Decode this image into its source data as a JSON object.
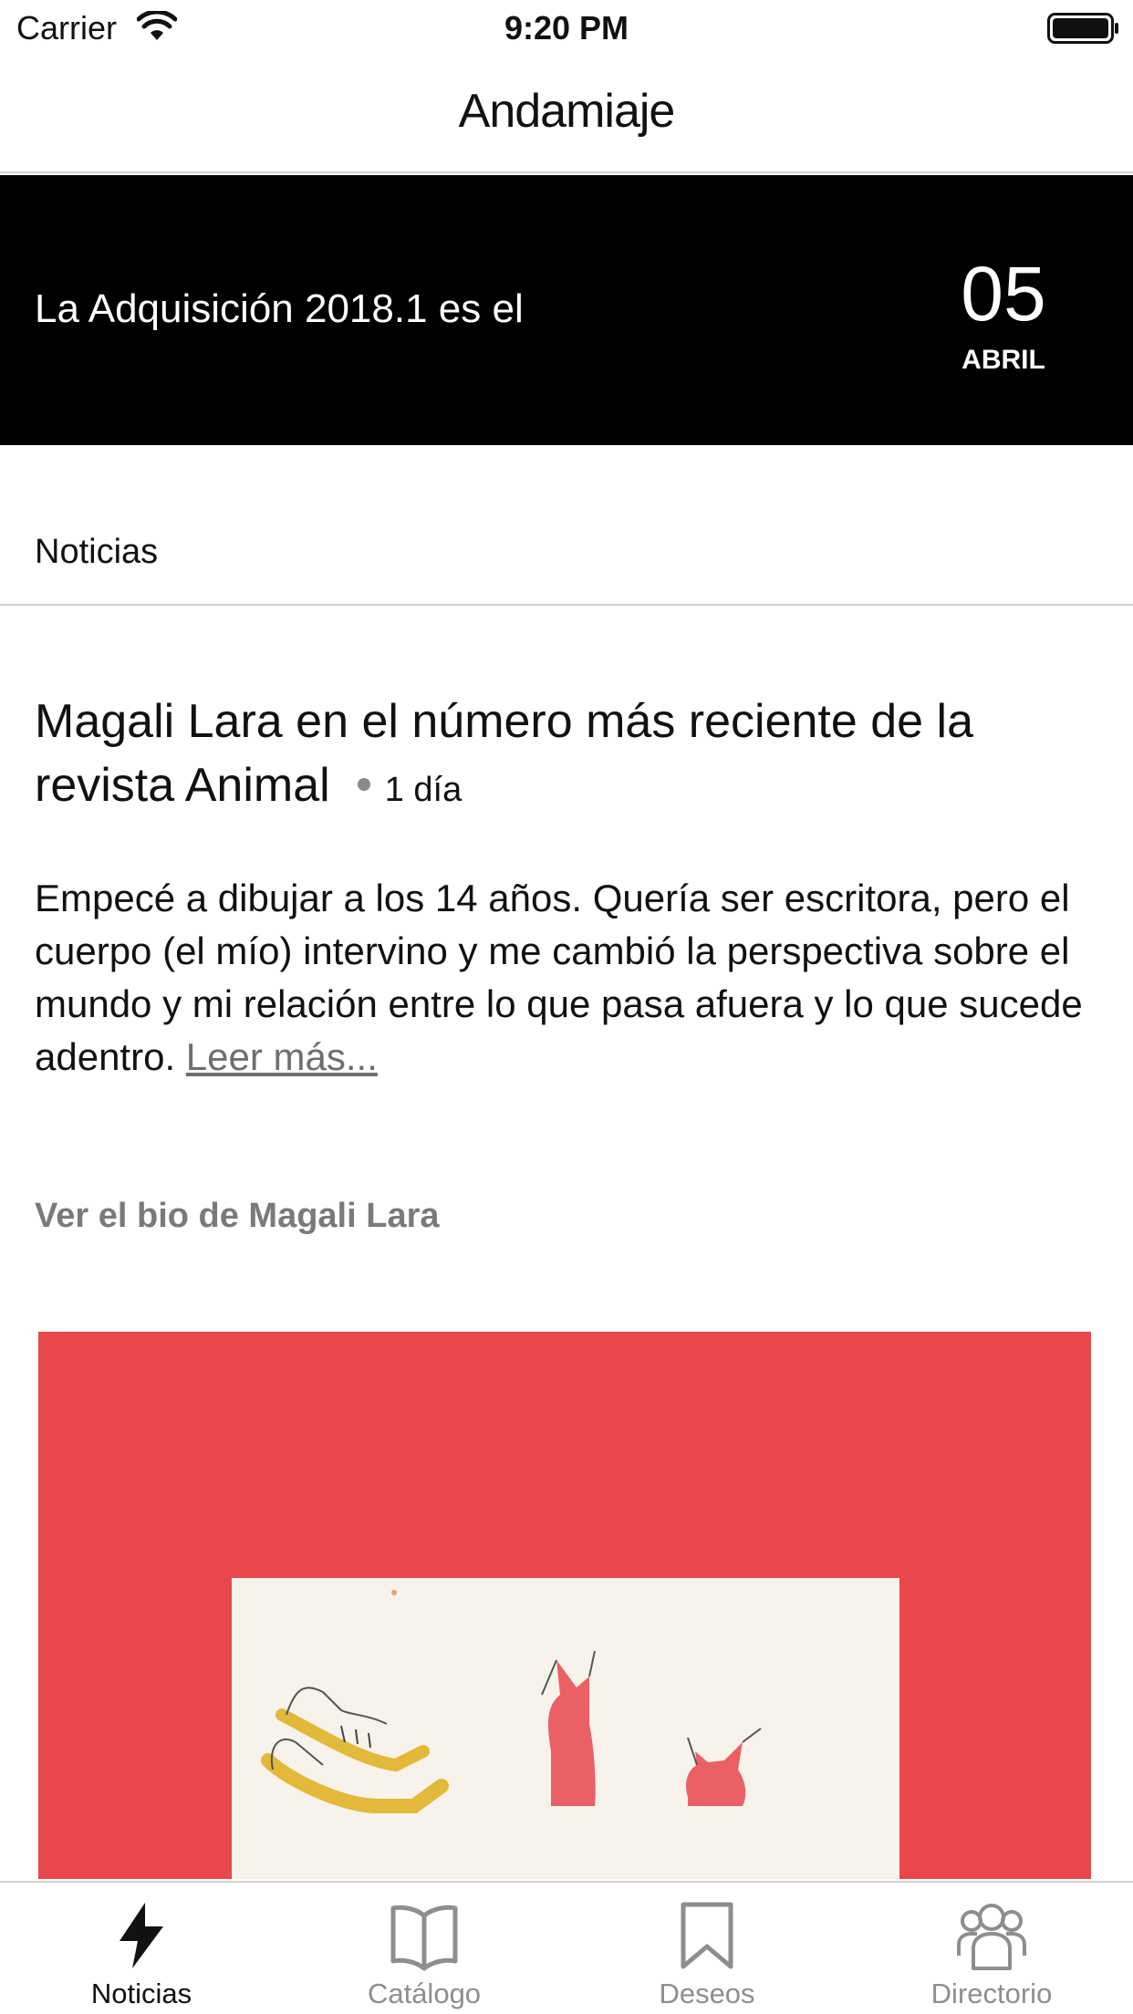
{
  "status_bar": {
    "carrier": "Carrier",
    "time": "9:20 PM",
    "icons": [
      "wifi-icon",
      "battery-icon"
    ]
  },
  "nav": {
    "title": "Andamiaje"
  },
  "banner": {
    "text": "La Adquisición 2018.1 es el",
    "day": "05",
    "month": "ABRIL"
  },
  "section": {
    "label": "Noticias"
  },
  "article": {
    "title": "Magali Lara en el número más reciente de la revista Animal",
    "age": "1 día",
    "body": "Empecé a dibujar a los 14 años. Quería ser escritora, pero el cuerpo (el mío) intervino y me cambió la perspectiva sobre el mundo y mi relación entre lo que pasa afuera y lo que sucede adentro.",
    "read_more": "Leer más...",
    "bio_link": "Ver el bio de Magali Lara",
    "image_background": "#e8474c"
  },
  "tab_bar": {
    "tabs": [
      {
        "label": "Noticias",
        "icon": "lightning-icon",
        "active": true
      },
      {
        "label": "Catálogo",
        "icon": "book-icon",
        "active": false
      },
      {
        "label": "Deseos",
        "icon": "bookmark-icon",
        "active": false
      },
      {
        "label": "Directorio",
        "icon": "people-icon",
        "active": false
      }
    ],
    "active_color": "#111111",
    "inactive_color": "#8e8e8e"
  }
}
